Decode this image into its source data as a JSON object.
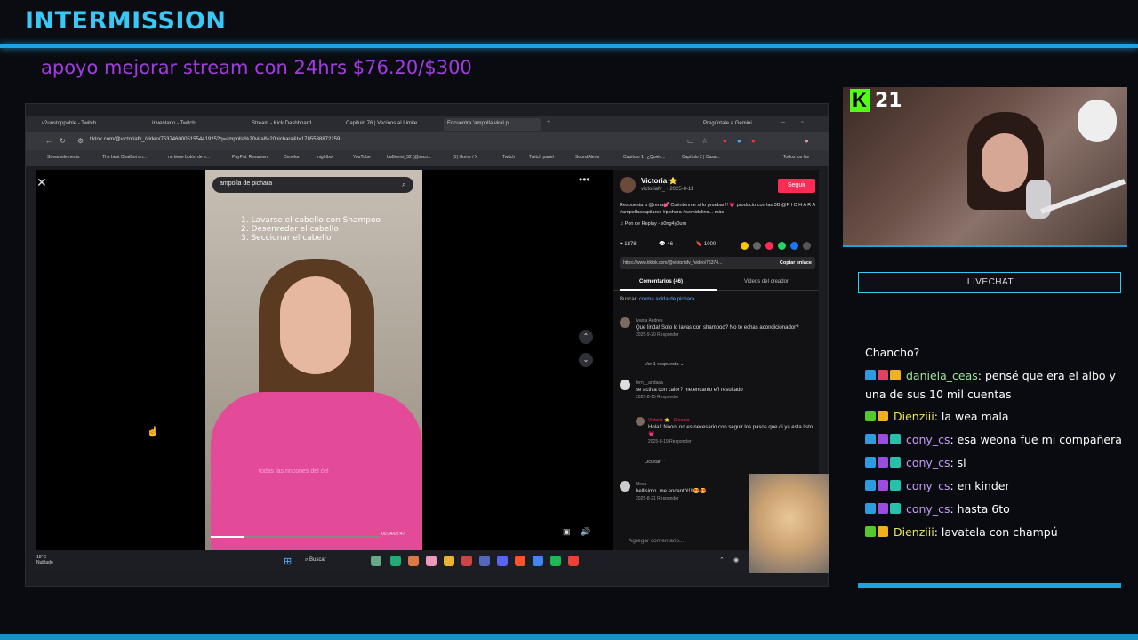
{
  "overlay": {
    "title": "INTERMISSION",
    "goal": "apoyo mejorar stream con 24hrs $76.20/$300",
    "viewers": "21",
    "livechat_label": "LIVECHAT"
  },
  "browser": {
    "tabs": [
      {
        "label": "v2unstoppable - Twitch"
      },
      {
        "label": "Inventario - Twitch"
      },
      {
        "label": "Stream - Kick Dashboard"
      },
      {
        "label": "Capitulo 76 | Vecinos al Limite"
      },
      {
        "label": "Encuentra 'ampolla viral p...",
        "active": true
      }
    ],
    "tab_right": "Pregúntale a Gemini",
    "url": "tiktok.com/@victoriafv_/video/7537460005155441925?q=ampolla%20viral%20pichara&t=1785538872259",
    "bookmarks": [
      "Streamelements",
      "The best ChatBot an...",
      "no tiene botón de e...",
      "PayPal: Resumen",
      "Ceneka",
      "nightbot",
      "YouTube",
      "LaBenini_52 (@ssco...",
      "(1) Home / X",
      "Twitch",
      "Twitch panel",
      "SoundAlerts",
      "Capítulo 1 | ¿Quién...",
      "Capítulo 2 | Casa...",
      "Todos los fav"
    ]
  },
  "tiktok": {
    "search_query": "ampolla de pichara",
    "steps": [
      "1. Lavarse el cabello con Shampoo",
      "2. Desenredar el cabello",
      "3. Seccionar el cabello"
    ],
    "caption_overlay": "todas las rincones del cel",
    "video_time": "00:34/02:47",
    "progress": 0.2,
    "author_name": "Victoria ⭐",
    "author_handle": "victoriafv_ · 2025-8-11",
    "follow_label": "Seguir",
    "description": "Respuesta a @rena💕 Cuéntenme si lo prueban!! 💗 producto con las 3B @P I C H A R A #ampollascapilares #pichara #semidolino... más",
    "music": "♫ Pon de Replay - s0ng4y0um",
    "likes": "1878",
    "comments_count": "46",
    "saves": "1000",
    "link": "https://www.tiktok.com/@victoriafv_/video/75374...",
    "copy_link_label": "Copiar enlace",
    "tab_comments": "Comentarios (46)",
    "tab_creator": "Videos del creador",
    "buscar_label": "Buscar:",
    "buscar_query": "crema acida de pichara",
    "comments": [
      {
        "user": "Ivania Andrea",
        "text": "Que linda! Solo lo lavas con shampoo? No te echas acondicionador?",
        "meta": "2025-9-20   Responder",
        "extra": "Ver 1 respuesta ⌄"
      },
      {
        "user": "fern__andaaa",
        "text": "se activa con calor? me.encanto eñ resultado",
        "meta": "2025-8-15   Responder"
      },
      {
        "user": "Victoria ⭐ · Creador",
        "text": "Hola!! Nooo, no es necesario con seguir los pasos que di ya esta listo💗",
        "meta": "2025-8-19   Responder",
        "extra": "Ocultar ⌃"
      },
      {
        "user": "Mesa",
        "text": "bellisimo..me encantó!!!!😍😍",
        "meta": "2025-8-21   Responder"
      }
    ],
    "add_comment_placeholder": "Agregar comentario..."
  },
  "taskbar": {
    "weather_temp": "18°C",
    "weather_desc": "Nublado",
    "search": "Buscar"
  },
  "chat": [
    {
      "user": "",
      "text": "Chancho?",
      "user_color": "#ffffff",
      "badges": []
    },
    {
      "user": "daniela_ceas",
      "text": ": pensé que era el albo y una de sus 10 mil cuentas",
      "user_color": "#9fe39a",
      "badges": [
        "#2d9be0",
        "#e2405e",
        "#f0b020"
      ]
    },
    {
      "user": "Dienziii",
      "text": ": la wea mala",
      "user_color": "#e8e55a",
      "badges": [
        "#53c92e",
        "#f0b020"
      ]
    },
    {
      "user": "cony_cs",
      "text": ": esa weona fue mi compañera",
      "user_color": "#c79af5",
      "badges": [
        "#2d9be0",
        "#9b4de0",
        "#27c0a8"
      ]
    },
    {
      "user": "cony_cs",
      "text": ": si",
      "user_color": "#c79af5",
      "badges": [
        "#2d9be0",
        "#9b4de0",
        "#27c0a8"
      ]
    },
    {
      "user": "cony_cs",
      "text": ": en kinder",
      "user_color": "#c79af5",
      "badges": [
        "#2d9be0",
        "#9b4de0",
        "#27c0a8"
      ]
    },
    {
      "user": "cony_cs",
      "text": ": hasta 6to",
      "user_color": "#c79af5",
      "badges": [
        "#2d9be0",
        "#9b4de0",
        "#27c0a8"
      ]
    },
    {
      "user": "Dienziii",
      "text": ": lavatela con champú",
      "user_color": "#e8e55a",
      "badges": [
        "#53c92e",
        "#f0b020"
      ]
    }
  ],
  "colors": {
    "accent": "#1fa3e0",
    "title": "#38c8f5",
    "goal": "#a23ce2",
    "kick": "#53fc18",
    "tiktok_follow": "#fe2c55"
  }
}
